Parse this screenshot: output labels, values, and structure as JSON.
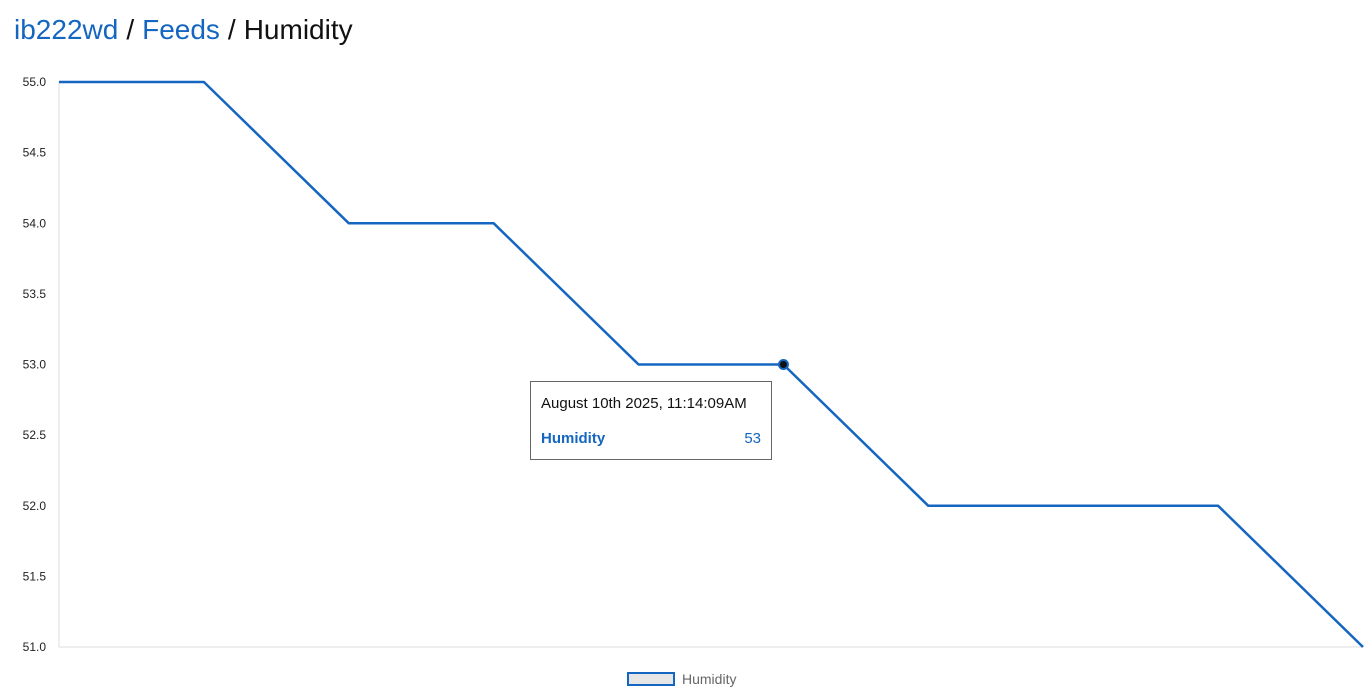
{
  "breadcrumb": {
    "user": "ib222wd",
    "section": "Feeds",
    "current": "Humidity",
    "separator": "/"
  },
  "colors": {
    "line": "#1466c0",
    "link": "#1466c0",
    "axis": "#dddddd",
    "tooltip_border": "#666666",
    "legend_fill": "#e6e6e6"
  },
  "tooltip": {
    "timestamp": "August 10th 2025, 11:14:09AM",
    "series": "Humidity",
    "value": "53"
  },
  "chart_data": {
    "type": "line",
    "title": "",
    "xlabel": "",
    "ylabel": "",
    "ylim": [
      51.0,
      55.0
    ],
    "y_ticks": [
      "55.0",
      "54.5",
      "54.0",
      "53.5",
      "53.0",
      "52.5",
      "52.0",
      "51.5",
      "51.0"
    ],
    "grid": false,
    "legend_position": "bottom-center",
    "highlighted_point_index": 5,
    "series": [
      {
        "name": "Humidity",
        "values": [
          55,
          55,
          54,
          54,
          53,
          53,
          52,
          52,
          52,
          51
        ]
      }
    ]
  },
  "legend": {
    "label": "Humidity"
  }
}
